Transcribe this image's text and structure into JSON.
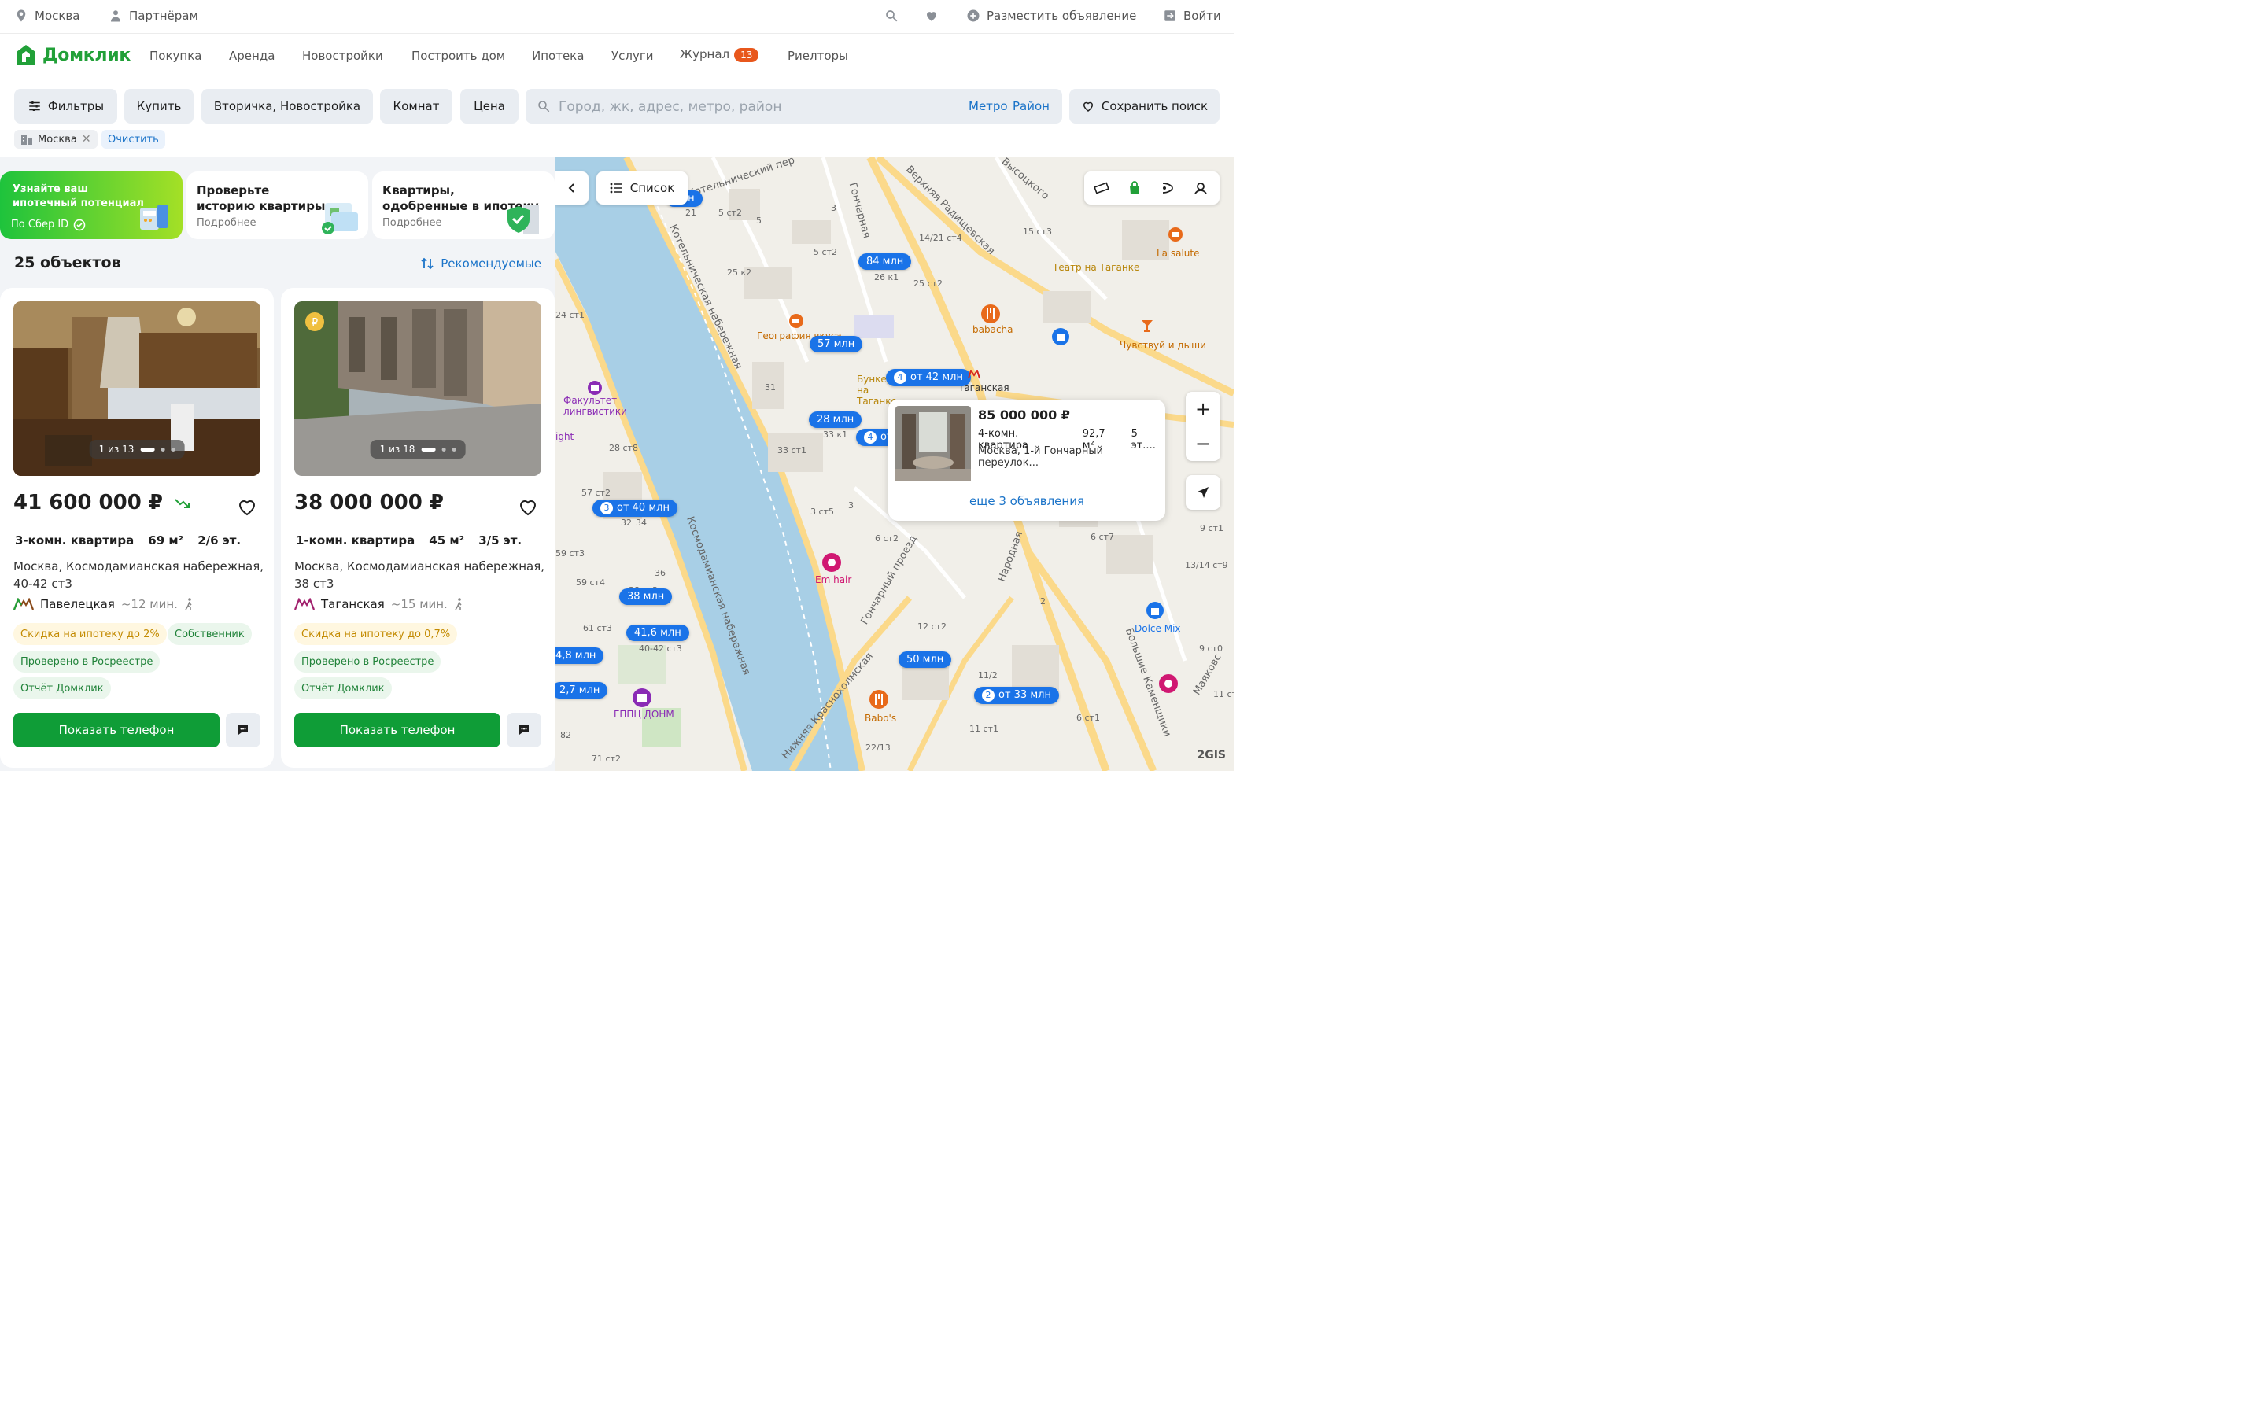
{
  "topbar": {
    "city": "Москва",
    "partners": "Партнёрам",
    "post_ad": "Разместить объявление",
    "login": "Войти"
  },
  "nav": {
    "logo": "Домклик",
    "links": [
      "Покупка",
      "Аренда",
      "Новостройки",
      "Построить дом",
      "Ипотека",
      "Услуги",
      "Журнал",
      "Риелторы"
    ],
    "journal_badge": "13"
  },
  "filters": {
    "filters_label": "Фильтры",
    "deal": "Купить",
    "market": "Вторичка, Новостройка",
    "rooms": "Комнат",
    "price": "Цена",
    "search_placeholder": "Город, жк, адрес, метро, район",
    "metro": "Метро",
    "district": "Район",
    "save_search": "Сохранить поиск",
    "chip_city": "Москва",
    "clear": "Очистить"
  },
  "promos": [
    {
      "title": "Узнайте ваш ипотечный потенциал",
      "sub": "По Сбер ID"
    },
    {
      "title": "Проверьте историю квартиры",
      "sub": "Подробнее"
    },
    {
      "title": "Квартиры, одобренные в ипотеку",
      "sub": "Подробнее"
    }
  ],
  "results": {
    "count": "25 объектов",
    "sort": "Рекомендуемые"
  },
  "cards": [
    {
      "photo_counter": "1 из 13",
      "price": "41 600 000 ₽",
      "rooms": "3-комн. квартира",
      "area": "69 м²",
      "floor": "2/6 эт.",
      "address": "Москва, Космодамианская набережная, 40-42 ст3",
      "metro": "Павелецкая",
      "walk": "~12 мин.",
      "tags": [
        "Скидка на ипотеку до 2%",
        "Собственник",
        "Проверено в Росреестре",
        "Отчёт Домклик"
      ],
      "call": "Показать телефон"
    },
    {
      "photo_counter": "1 из 18",
      "price": "38 000 000 ₽",
      "rooms": "1-комн. квартира",
      "area": "45 м²",
      "floor": "3/5 эт.",
      "address": "Москва, Космодамианская набережная, 38 ст3",
      "metro": "Таганская",
      "walk": "~15 мин.",
      "tags": [
        "Скидка на ипотеку до 0,7%",
        "Проверено в Росреестре",
        "Отчёт Домклик"
      ],
      "call": "Показать телефон"
    }
  ],
  "map": {
    "list_button": "Список",
    "pins": [
      "млн",
      "84 млн",
      "57 млн",
      "от 42 млн",
      "28 млн",
      "от",
      "от 40 млн",
      "38 млн",
      "41,6 млн",
      "4,8 млн",
      "2,7 млн",
      "50 млн",
      "от 33 млн"
    ],
    "pin_counts": [
      "4",
      "4",
      "3",
      "2"
    ],
    "streets": [
      "Котельнический пер",
      "Гончарная",
      "Верхняя Радищевская",
      "Высоцкого",
      "Котельническая набережная",
      "Космодамианская набережная",
      "Гончарный проезд",
      "Народная",
      "Нижняя Краснохолмская",
      "Большие Каменщики",
      "Маяковс"
    ],
    "pois": [
      "География вкуса",
      "babacha",
      "La salute",
      "Театр на Таганке",
      "Чувствуй и дыши",
      "Бункер на Таганке",
      "Таганская",
      "Факультет лингвистики",
      "Em hair",
      "Babo's",
      "ГППЦ ДОНМ",
      "Dolce Mix",
      "ight"
    ],
    "house_numbers": [
      "21",
      "5 ст2",
      "3",
      "5",
      "5 ст2",
      "25 к2",
      "26 к1",
      "14/21 ст4",
      "15 ст3",
      "25 ст2",
      "24 ст1",
      "31",
      "33 к1",
      "33 ст1",
      "28 ст8",
      "57 ст2",
      "32",
      "34",
      "3 ст5",
      "3",
      "6 ст2",
      "59 ст3",
      "59 ст4",
      "36",
      "38 ст3",
      "61 ст3",
      "40-42 ст3",
      "12 ст2",
      "2",
      "11/2",
      "9 ст1",
      "6 ст7",
      "13/14 ст9",
      "9 ст0",
      "11 ст1",
      "6 ст1",
      "22/13",
      "82",
      "71 ст2",
      "11 ст"
    ],
    "popup": {
      "price": "85 000 000 ₽",
      "rooms": "4-комн. квартира",
      "area": "92,7 м²",
      "floor": "5 эт....",
      "address": "Москва, 1-й Гончарный переулок...",
      "more": "еще 3 объявления"
    },
    "zoom_in": "+",
    "zoom_out": "−",
    "attribution": "2GIS"
  },
  "colors": {
    "brand_green": "#21a038",
    "button_green": "#0f9d37",
    "link_blue": "#1a73c8",
    "pin_blue": "#1a73e8",
    "badge_orange": "#e8571c"
  }
}
